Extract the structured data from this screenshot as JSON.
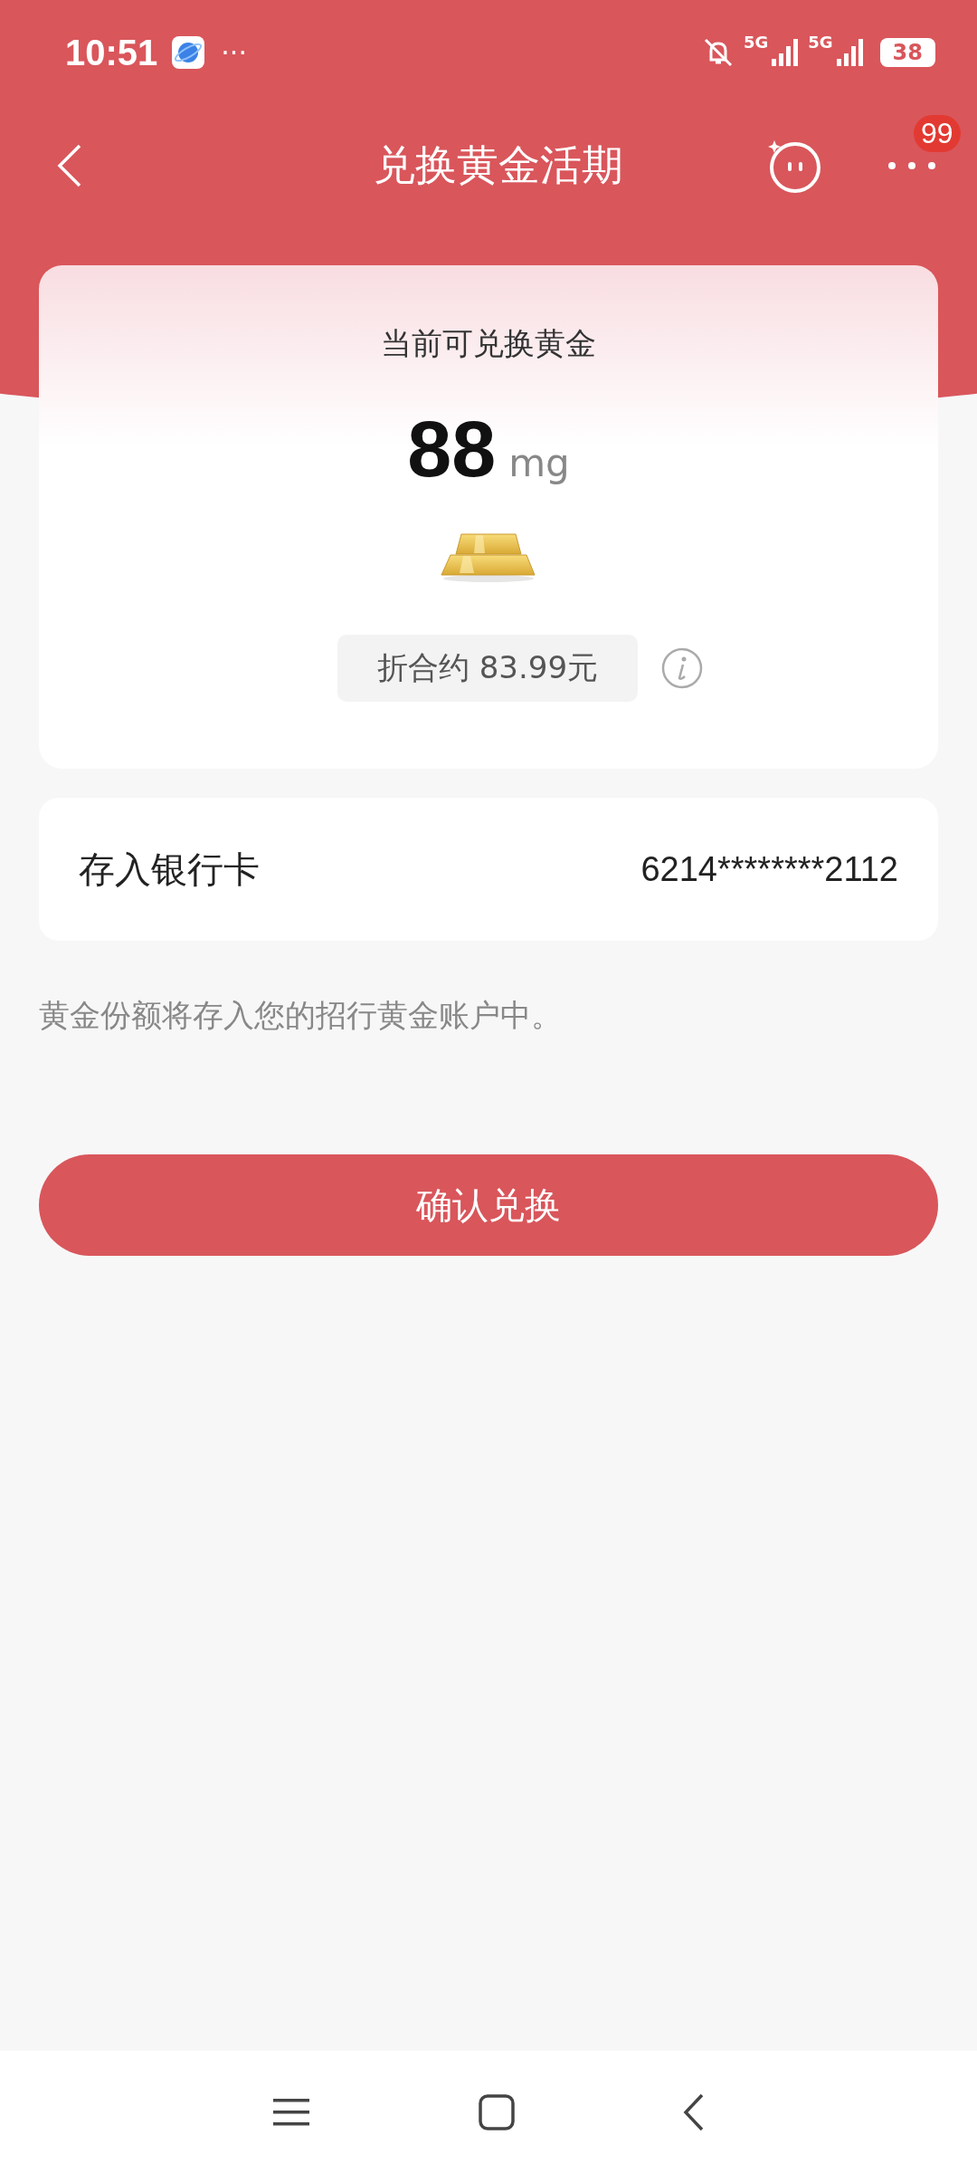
{
  "status_bar": {
    "time": "10:51",
    "more": "···",
    "network_1": "5G",
    "network_2": "5G",
    "battery": "38"
  },
  "header": {
    "title": "兑换黄金活期",
    "badge": "99"
  },
  "summary": {
    "label": "当前可兑换黄金",
    "amount": "88",
    "unit": "mg",
    "equivalent": "折合约 83.99元"
  },
  "card_row": {
    "label": "存入银行卡",
    "value": "6214********2112"
  },
  "note": "黄金份额将存入您的招行黄金账户中。",
  "confirm_button": "确认兑换"
}
